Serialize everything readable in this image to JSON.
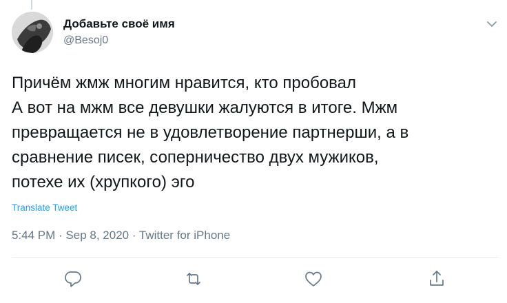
{
  "user": {
    "display_name": "Добавьте своё имя",
    "handle": "@Besoj0"
  },
  "tweet": {
    "lines": [
      "Причём жмж многим нравится, кто пробовал",
      "А вот на мжм все девушки жалуются в итоге. Мжм",
      "превращается не в удовлетворение партнерши, а в",
      "сравнение писек, соперничество двух мужиков,",
      "потехе их (хрупкого) эго"
    ],
    "translate_label": "Translate Tweet",
    "meta": "5:44 PM · Sep 8, 2020 · Twitter for iPhone"
  },
  "actions": {
    "reply_icon": "reply-icon",
    "retweet_icon": "retweet-icon",
    "like_icon": "like-icon",
    "share_icon": "share-icon"
  },
  "colors": {
    "text": "#14171a",
    "secondary": "#657786",
    "accent": "#1da1f2"
  }
}
